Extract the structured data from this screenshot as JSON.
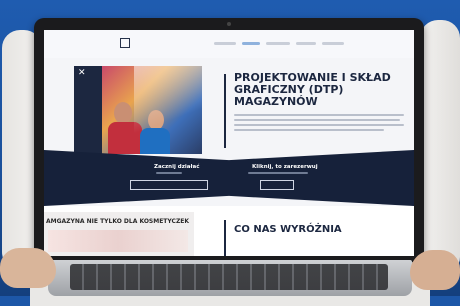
{
  "hero": {
    "title": "PROJEKTOWANIE I SKŁAD GRAFICZNY (DTP) MAGAZYNÓW"
  },
  "band": {
    "left_title": "Zacznij działać",
    "right_title": "Kliknij, to zarezerwuj"
  },
  "promo": {
    "text": "AMGAZYNA NIE TYLKO DLA KOSMETYCZEK"
  },
  "section": {
    "title": "CO NAS WYRÓŻNIA"
  },
  "colors": {
    "background": "#1d57a8",
    "navy": "#16213a",
    "page": "#f4f5f8"
  }
}
